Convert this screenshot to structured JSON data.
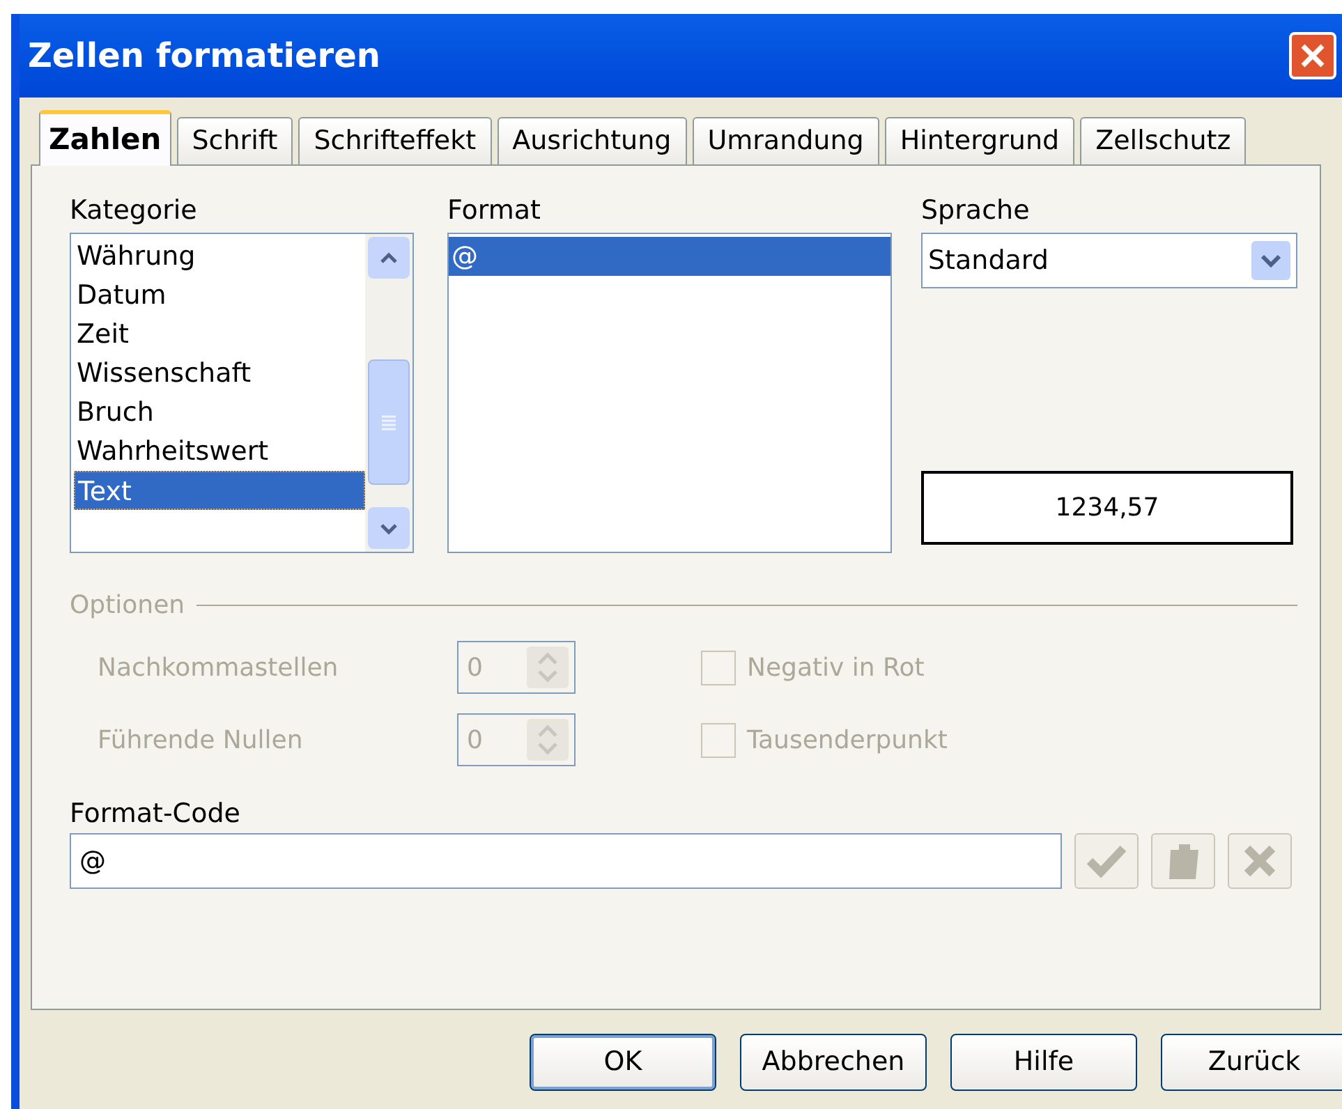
{
  "window": {
    "title": "Zellen formatieren"
  },
  "tabs": [
    {
      "label": "Zahlen",
      "selected": true
    },
    {
      "label": "Schrift",
      "selected": false
    },
    {
      "label": "Schrifteffekt",
      "selected": false
    },
    {
      "label": "Ausrichtung",
      "selected": false
    },
    {
      "label": "Umrandung",
      "selected": false
    },
    {
      "label": "Hintergrund",
      "selected": false
    },
    {
      "label": "Zellschutz",
      "selected": false
    }
  ],
  "category": {
    "label": "Kategorie",
    "items": [
      {
        "label": "Währung",
        "selected": false
      },
      {
        "label": "Datum",
        "selected": false
      },
      {
        "label": "Zeit",
        "selected": false
      },
      {
        "label": "Wissenschaft",
        "selected": false
      },
      {
        "label": "Bruch",
        "selected": false
      },
      {
        "label": "Wahrheitswert",
        "selected": false
      },
      {
        "label": "Text",
        "selected": true
      }
    ]
  },
  "format": {
    "label": "Format",
    "items": [
      {
        "label": "@",
        "selected": true
      }
    ]
  },
  "language": {
    "label": "Sprache",
    "value": "Standard"
  },
  "preview": "1234,57",
  "options": {
    "label": "Optionen",
    "disabled": true,
    "rows": [
      {
        "label": "Nachkommastellen",
        "value": "0"
      },
      {
        "label": "Führende Nullen",
        "value": "0"
      }
    ],
    "checkboxes": [
      {
        "label": "Negativ in Rot",
        "checked": false
      },
      {
        "label": "Tausenderpunkt",
        "checked": false
      }
    ]
  },
  "format_code": {
    "label": "Format-Code",
    "value": "@",
    "tools": [
      {
        "kind": "check",
        "disabled": true
      },
      {
        "kind": "comment",
        "disabled": true
      },
      {
        "kind": "delete",
        "disabled": true
      }
    ]
  },
  "buttons": [
    {
      "label": "OK",
      "default": true
    },
    {
      "label": "Abbrechen",
      "default": false
    },
    {
      "label": "Hilfe",
      "default": false
    },
    {
      "label": "Zurück",
      "default": false
    }
  ]
}
